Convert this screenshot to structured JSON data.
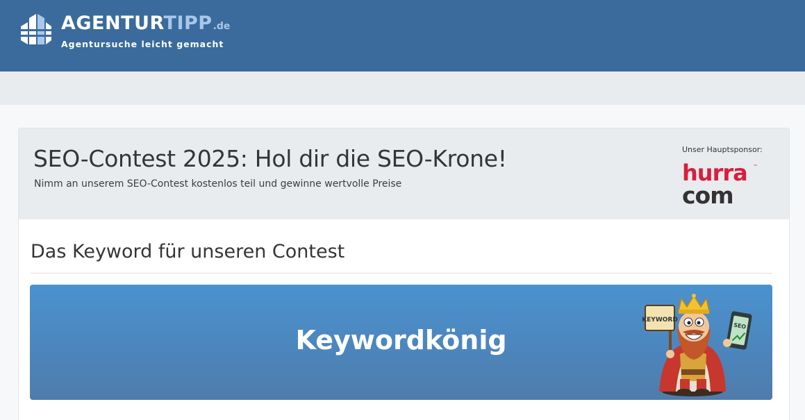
{
  "header": {
    "logo_title_main": "AGENTUR",
    "logo_title_accent": "TIPP",
    "logo_title_tld": ".de",
    "logo_tagline": "Agentursuche leicht gemacht",
    "colors": {
      "bar": "#3a6b9c",
      "accent": "#a8c8ea"
    }
  },
  "contest": {
    "title": "SEO-Contest 2025: Hol dir die SEO-Krone!",
    "subtitle": "Nimm an unserem SEO-Contest kostenlos teil und gewinne wertvolle Preise",
    "sponsor_label": "Unser Hauptsponsor:",
    "sponsor_logo": {
      "line1": "hurra",
      "line2": "com",
      "tm": "™",
      "colors": {
        "brand_red": "#d81e3f",
        "brand_dark": "#333333"
      }
    }
  },
  "keyword_section": {
    "heading": "Das Keyword für unseren Contest",
    "keyword": "Keywordkönig",
    "mascot": {
      "sign_text": "KEYWORD",
      "phone_text": "SEO",
      "icon": "king-mascot"
    }
  }
}
